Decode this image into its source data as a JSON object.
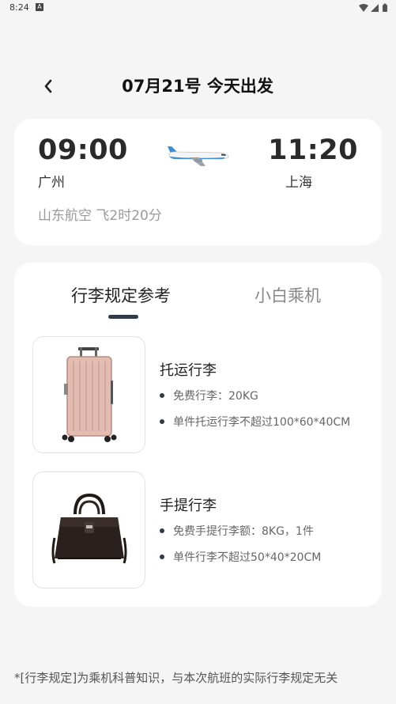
{
  "status_bar": {
    "time": "8:24",
    "notification_badge": "A",
    "icons": [
      "wifi-icon",
      "signal-icon",
      "battery-icon"
    ]
  },
  "header": {
    "back_icon": "chevron-left-icon",
    "title": "07月21号 今天出发"
  },
  "flight": {
    "departure_time": "09:00",
    "departure_city": "广州",
    "arrival_time": "11:20",
    "arrival_city": "上海",
    "info": "山东航空 飞2时20分",
    "plane_icon": "airplane-icon"
  },
  "tabs": [
    {
      "label": "行李规定参考",
      "active": true
    },
    {
      "label": "小白乘机",
      "active": false
    }
  ],
  "baggage_items": [
    {
      "image": "suitcase-image",
      "title": "托运行李",
      "rules": [
        "免费行李：20KG",
        "单件托运行李不超过100*60*40CM"
      ]
    },
    {
      "image": "handbag-image",
      "title": "手提行李",
      "rules": [
        "免费手提行李额：8KG，1件",
        "单件行李不超过50*40*20CM"
      ]
    }
  ],
  "footnote": "*[行李规定]为乘机科普知识，与本次航班的实际行李规定无关",
  "colors": {
    "background": "#f5f5f5",
    "card": "#ffffff",
    "indicator": "#2f3b47",
    "muted_text": "#9a9a9a"
  }
}
